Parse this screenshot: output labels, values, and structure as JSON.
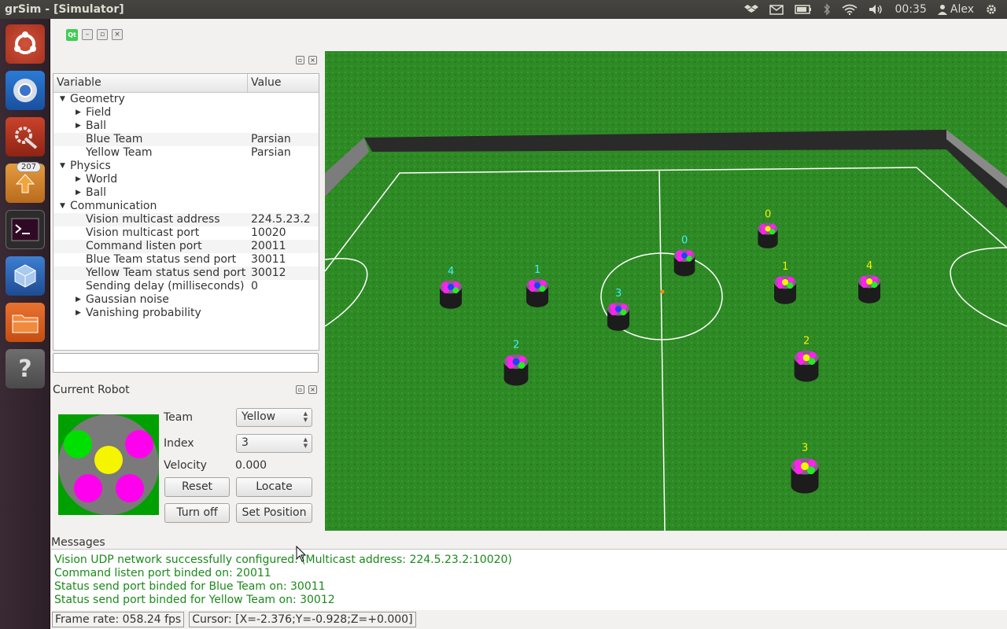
{
  "window": {
    "title": "grSim - [Simulator]"
  },
  "topbar": {
    "time": "00:35",
    "user": "Alex"
  },
  "launcher": {
    "badge_count": "207"
  },
  "tree": {
    "headers": {
      "variable": "Variable",
      "value": "Value"
    },
    "rows": [
      {
        "label": "Geometry",
        "value": ""
      },
      {
        "label": "Field",
        "value": ""
      },
      {
        "label": "Ball",
        "value": ""
      },
      {
        "label": "Blue Team",
        "value": "Parsian"
      },
      {
        "label": "Yellow Team",
        "value": "Parsian"
      },
      {
        "label": "Physics",
        "value": ""
      },
      {
        "label": "World",
        "value": ""
      },
      {
        "label": "Ball",
        "value": ""
      },
      {
        "label": "Communication",
        "value": ""
      },
      {
        "label": "Vision multicast address",
        "value": "224.5.23.2"
      },
      {
        "label": "Vision multicast port",
        "value": "10020"
      },
      {
        "label": "Command listen port",
        "value": "20011"
      },
      {
        "label": "Blue Team status send port",
        "value": "30011"
      },
      {
        "label": "Yellow Team status send port",
        "value": "30012"
      },
      {
        "label": "Sending delay (milliseconds)",
        "value": "0"
      },
      {
        "label": "Gaussian noise",
        "value": ""
      },
      {
        "label": "Vanishing probability",
        "value": ""
      }
    ]
  },
  "current_robot": {
    "title": "Current Robot",
    "team_label": "Team",
    "team_value": "Yellow",
    "index_label": "Index",
    "index_value": "3",
    "velocity_label": "Velocity",
    "velocity_value": "0.000",
    "reset": "Reset",
    "locate": "Locate",
    "turn_off": "Turn off",
    "set_position": "Set Position"
  },
  "robots": {
    "blue": [
      "4",
      "1",
      "3",
      "0",
      "2"
    ],
    "yellow": [
      "0",
      "1",
      "4",
      "2",
      "3"
    ]
  },
  "messages": {
    "title": "Messages",
    "lines": [
      "Vision UDP network successfully configured. (Multicast address: 224.5.23.2:10020)",
      "Command listen port binded on: 20011",
      "Status send port binded for Blue Team on: 30011",
      "Status send port binded for Yellow Team on: 30012"
    ]
  },
  "status": {
    "frame_rate": "Frame rate: 058.24 fps",
    "cursor": "Cursor: [X=-2.376;Y=-0.928;Z=+0.000]"
  }
}
